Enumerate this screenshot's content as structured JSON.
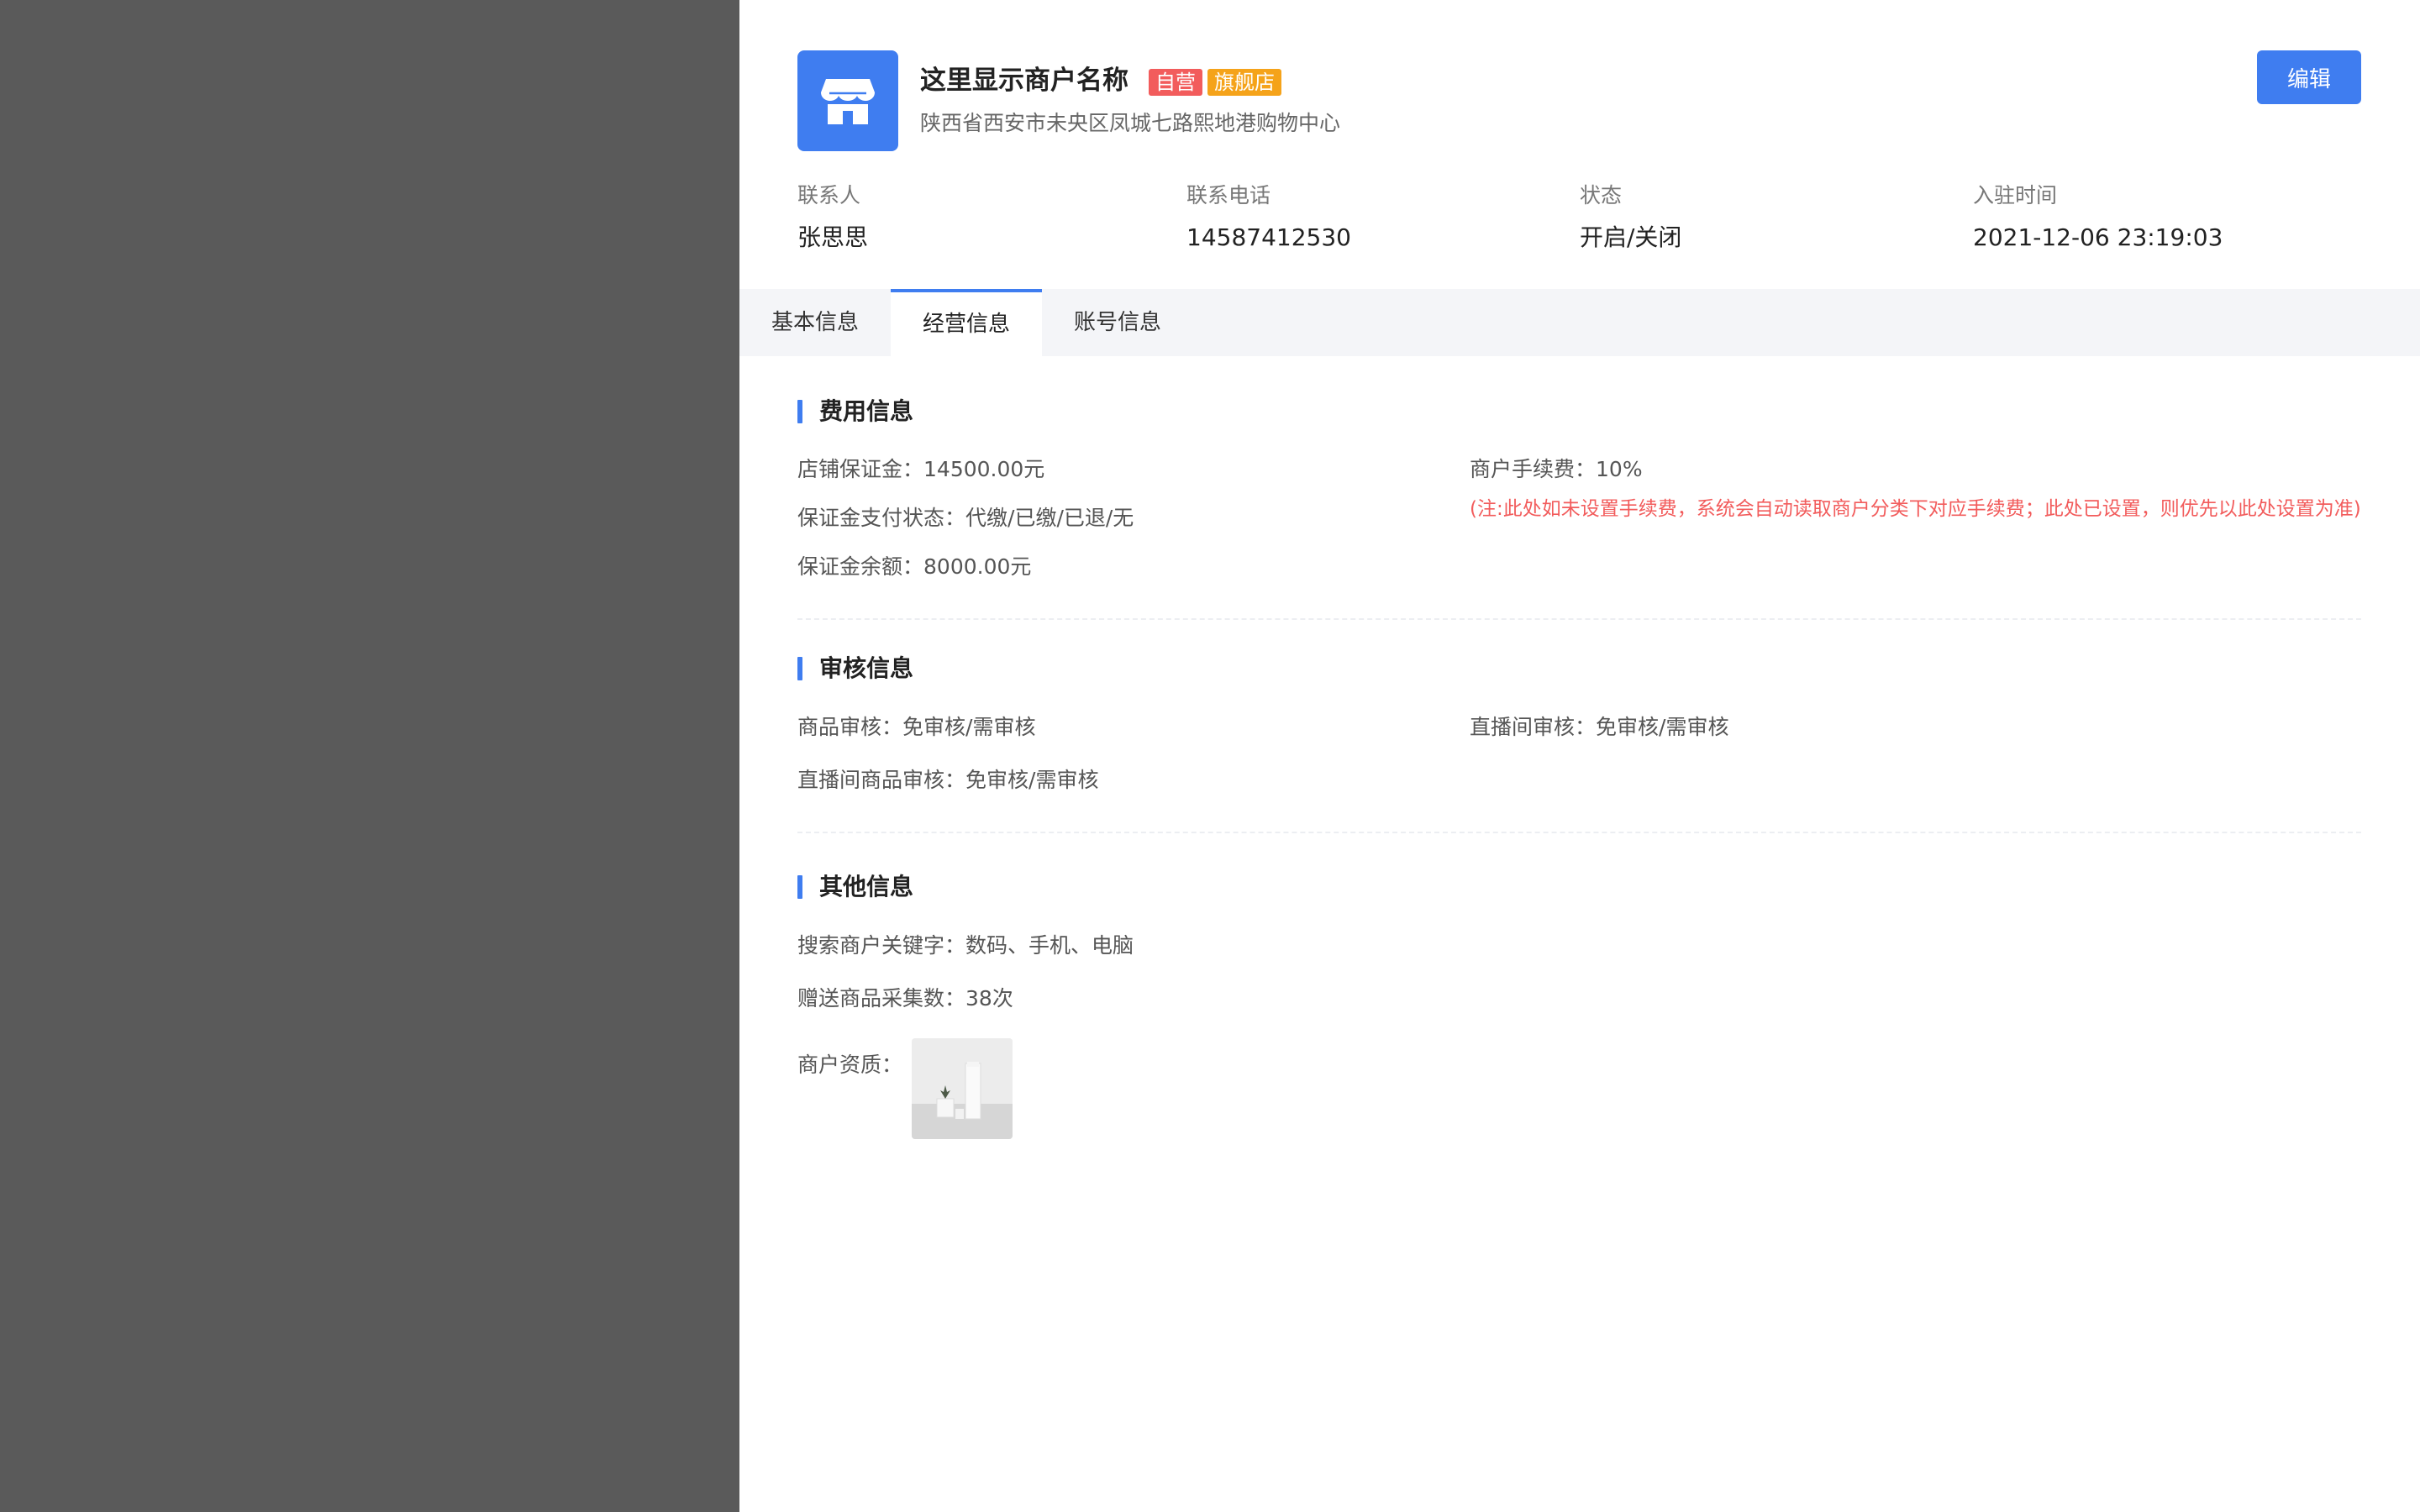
{
  "header": {
    "shop_name": "这里显示商户名称",
    "tags": {
      "self_operated": "自营",
      "flagship": "旗舰店"
    },
    "address": "陕西省西安市未央区凤城七路熙地港购物中心",
    "edit_label": "编辑"
  },
  "info": {
    "contact": {
      "label": "联系人",
      "value": "张思思"
    },
    "phone": {
      "label": "联系电话",
      "value": "14587412530"
    },
    "status": {
      "label": "状态",
      "value": "开启/关闭"
    },
    "joined": {
      "label": "入驻时间",
      "value": "2021-12-06 23:19:03"
    }
  },
  "tabs": [
    {
      "label": "基本信息",
      "active": false
    },
    {
      "label": "经营信息",
      "active": true
    },
    {
      "label": "账号信息",
      "active": false
    }
  ],
  "fees": {
    "title": "费用信息",
    "deposit": {
      "key": "店铺保证金：",
      "value": "14500.00元"
    },
    "deposit_status": {
      "key": "保证金支付状态：",
      "value": "代缴/已缴/已退/无"
    },
    "deposit_balance": {
      "key": "保证金余额：",
      "value": "8000.00元"
    },
    "commission": {
      "key": "商户手续费：",
      "value": "10%"
    },
    "commission_note": "(注:此处如未设置手续费，系统会自动读取商户分类下对应手续费；此处已设置，则优先以此处设置为准)"
  },
  "review": {
    "title": "审核信息",
    "product": {
      "key": "商品审核：",
      "value": "免审核/需审核"
    },
    "live_room": {
      "key": "直播间审核：",
      "value": "免审核/需审核"
    },
    "live_product": {
      "key": "直播间商品审核：",
      "value": "免审核/需审核"
    }
  },
  "other": {
    "title": "其他信息",
    "keywords": {
      "key": "搜索商户关键字：",
      "value": "数码、手机、电脑"
    },
    "collect_count": {
      "key": "赠送商品采集数：",
      "value": "38次"
    },
    "qualification": {
      "key": "商户资质："
    }
  },
  "colors": {
    "accent": "#3f7df0",
    "tag_self": "#f25c5c",
    "tag_flagship": "#f5a31a",
    "note_red": "#f25c5c",
    "overlay": "#5a5a5a"
  },
  "icons": {
    "logo": "store-icon"
  }
}
